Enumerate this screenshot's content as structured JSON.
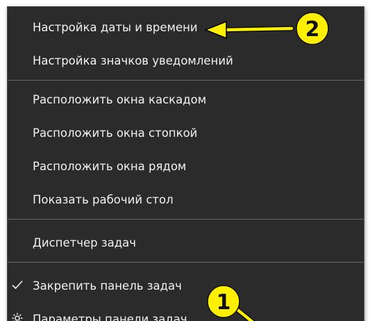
{
  "menu": {
    "items": [
      {
        "label": "Настройка даты и времени"
      },
      {
        "label": "Настройка значков уведомлений"
      },
      {
        "label": "Расположить окна каскадом"
      },
      {
        "label": "Расположить окна стопкой"
      },
      {
        "label": "Расположить окна рядом"
      },
      {
        "label": "Показать рабочий стол"
      },
      {
        "label": "Диспетчер задач"
      },
      {
        "label": "Закрепить панель задач",
        "checked": true
      },
      {
        "label": "Параметры панели задач",
        "icon": "gear-icon"
      }
    ]
  },
  "annotations": {
    "badge_1": "1",
    "badge_2": "2",
    "badge_color": "#ffef00",
    "arrow_color": "#ffef00",
    "menu_bg": "#2b2b2b",
    "text_color": "#f2f2f2"
  }
}
